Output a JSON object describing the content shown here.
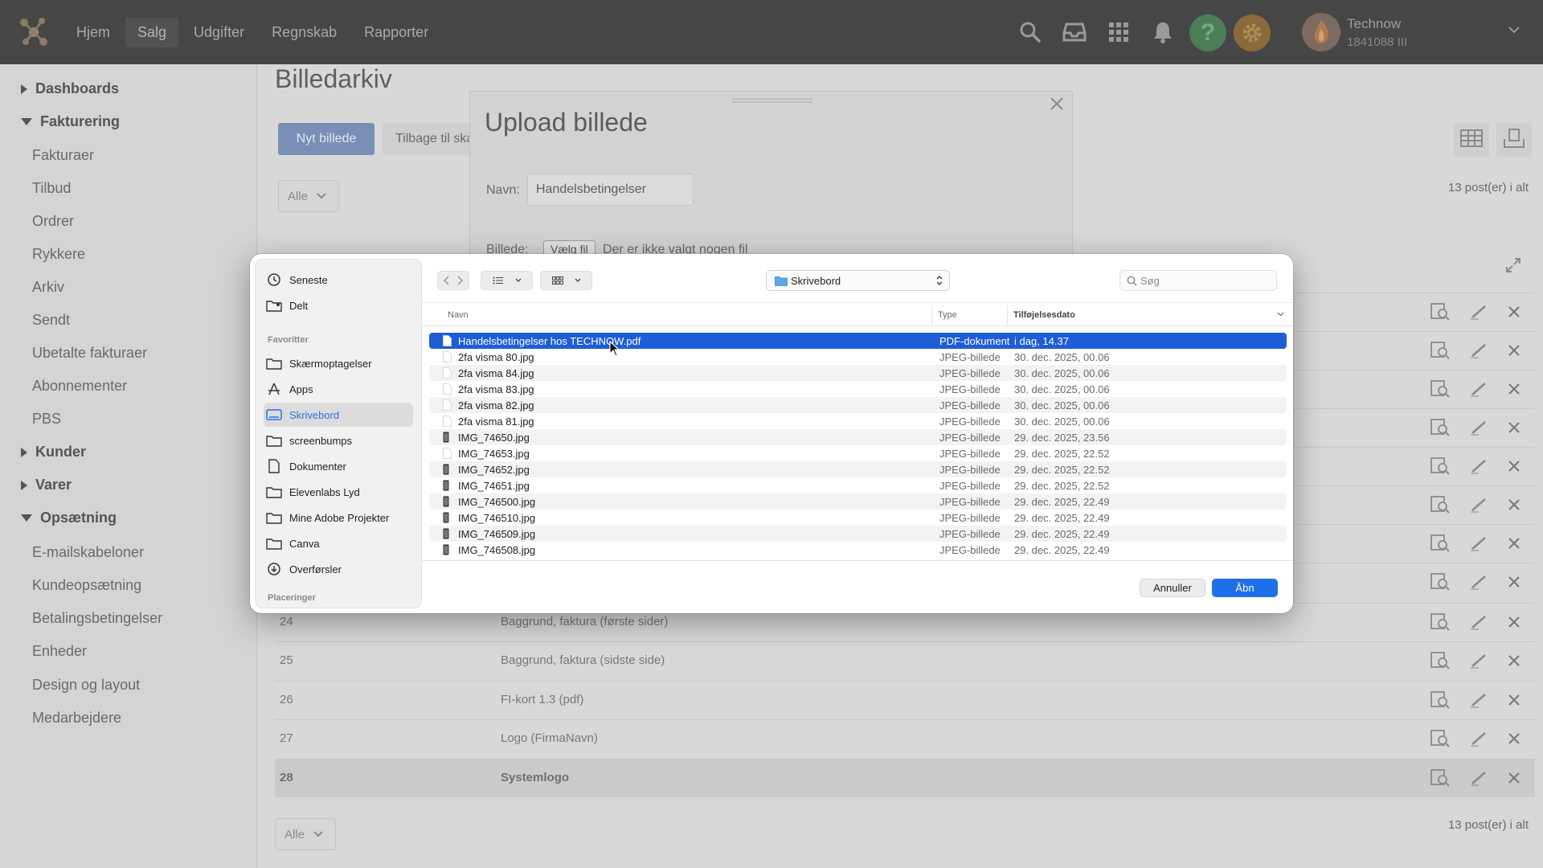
{
  "nav": {
    "items": [
      "Hjem",
      "Salg",
      "Udgifter",
      "Regnskab",
      "Rapporter"
    ],
    "active": "Salg"
  },
  "user": {
    "name": "Technow",
    "id": "1841088 III"
  },
  "sidebar": {
    "dashboards": "Dashboards",
    "fakturering": "Fakturering",
    "fakturering_items": [
      "Fakturaer",
      "Tilbud",
      "Ordrer",
      "Rykkere",
      "Arkiv",
      "Sendt",
      "Ubetalte fakturaer",
      "Abonnementer",
      "PBS"
    ],
    "kunder": "Kunder",
    "varer": "Varer",
    "opsaetning": "Opsætning",
    "opsaetning_items": [
      "E-mailskabeloner",
      "Kundeopsætning",
      "Betalingsbetingelser",
      "Enheder",
      "Design og layout",
      "Medarbejdere"
    ]
  },
  "page": {
    "title": "Billedarkiv",
    "new_button": "Nyt billede",
    "back_button": "Tilbage til skabeloner",
    "filter_value": "Alle",
    "post_count": "13 post(er) i alt",
    "rows": [
      {
        "id": "24",
        "name": "Baggrund, faktura (første sider)"
      },
      {
        "id": "25",
        "name": "Baggrund, faktura (sidste side)"
      },
      {
        "id": "26",
        "name": "FI-kort 1.3 (pdf)"
      },
      {
        "id": "27",
        "name": "Logo (FirmaNavn)"
      },
      {
        "id": "28",
        "name": "Systemlogo"
      }
    ]
  },
  "upload_modal": {
    "title": "Upload billede",
    "name_label": "Navn:",
    "name_value": "Handelsbetingelser",
    "file_label": "Billede:",
    "file_button": "Vælg fil",
    "file_none": "Der er ikke valgt nogen fil"
  },
  "file_dialog": {
    "location": "Skrivebord",
    "search_placeholder": "Søg",
    "sidebar": {
      "top_items": [
        "Seneste",
        "Delt"
      ],
      "favorites_heading": "Favoritter",
      "favorites": [
        "Skærmoptagelser",
        "Apps",
        "Skrivebord",
        "screenbumps",
        "Dokumenter",
        "Elevenlabs Lyd",
        "Mine Adobe Projekter",
        "Canva",
        "Overførsler"
      ],
      "selected": "Skrivebord",
      "locations_heading": "Placeringer"
    },
    "columns": {
      "name": "Navn",
      "type": "Type",
      "date": "Tilføjelsesdato"
    },
    "files": [
      {
        "name": "Handelsbetingelser hos TECHNOW.pdf",
        "type": "PDF-dokument",
        "date": "i dag, 14.37",
        "selected": true,
        "icon": "pdf"
      },
      {
        "name": "2fa visma 80.jpg",
        "type": "JPEG-billede",
        "date": "30. dec. 2025, 00.06",
        "icon": "image"
      },
      {
        "name": "2fa visma 84.jpg",
        "type": "JPEG-billede",
        "date": "30. dec. 2025, 00.06",
        "icon": "image"
      },
      {
        "name": "2fa visma 83.jpg",
        "type": "JPEG-billede",
        "date": "30. dec. 2025, 00.06",
        "icon": "image"
      },
      {
        "name": "2fa visma 82.jpg",
        "type": "JPEG-billede",
        "date": "30. dec. 2025, 00.06",
        "icon": "image"
      },
      {
        "name": "2fa visma 81.jpg",
        "type": "JPEG-billede",
        "date": "30. dec. 2025, 00.06",
        "icon": "image"
      },
      {
        "name": "IMG_74650.jpg",
        "type": "JPEG-billede",
        "date": "29. dec. 2025, 23.56",
        "icon": "phone-image"
      },
      {
        "name": "IMG_74653.jpg",
        "type": "JPEG-billede",
        "date": "29. dec. 2025, 22.52",
        "icon": "image"
      },
      {
        "name": "IMG_74652.jpg",
        "type": "JPEG-billede",
        "date": "29. dec. 2025, 22.52",
        "icon": "phone-image"
      },
      {
        "name": "IMG_74651.jpg",
        "type": "JPEG-billede",
        "date": "29. dec. 2025, 22.52",
        "icon": "phone-image"
      },
      {
        "name": "IMG_746500.jpg",
        "type": "JPEG-billede",
        "date": "29. dec. 2025, 22.49",
        "icon": "phone-image"
      },
      {
        "name": "IMG_746510.jpg",
        "type": "JPEG-billede",
        "date": "29. dec. 2025, 22.49",
        "icon": "phone-image"
      },
      {
        "name": "IMG_746509.jpg",
        "type": "JPEG-billede",
        "date": "29. dec. 2025, 22.49",
        "icon": "phone-image"
      },
      {
        "name": "IMG_746508.jpg",
        "type": "JPEG-billede",
        "date": "29. dec. 2025, 22.49",
        "icon": "phone-image"
      }
    ],
    "cancel_button": "Annuller",
    "open_button": "Åbn"
  },
  "colors": {
    "topbar": "#464646",
    "selection_blue": "#1f5dd8",
    "open_button": "#1f6fe8",
    "help_green": "#4b7e57",
    "settings_orange": "#8a6a3a"
  }
}
